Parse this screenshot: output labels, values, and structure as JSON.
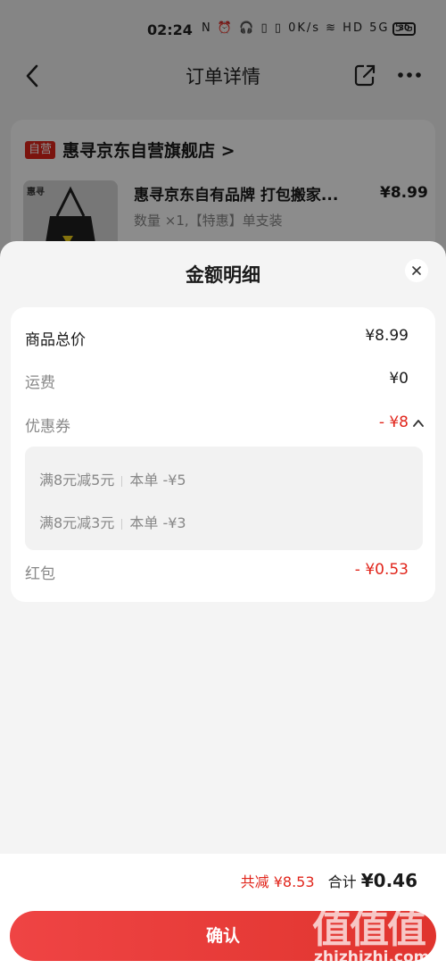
{
  "status_bar": {
    "time": "02:24",
    "icons_text": "N ⏰ 🎧 ▯ ▯ 0K/s ≋ HD 5G 5G",
    "battery": "30"
  },
  "nav": {
    "title": "订单详情",
    "icons": [
      "back-icon",
      "share-icon",
      "more-icon"
    ]
  },
  "store": {
    "badge": "自营",
    "name": "惠寻京东自营旗舰店 >",
    "product": {
      "thumb_tag": "惠寻",
      "title": "惠寻京东自有品牌 打包搬家...",
      "price": "¥8.99",
      "spec": "数量 ×1,【特惠】单支装"
    }
  },
  "sheet": {
    "title": "金额明细",
    "rows": {
      "total": {
        "label": "商品总价",
        "value": "¥8.99"
      },
      "shipping": {
        "label": "运费",
        "value": "¥0"
      },
      "coupon": {
        "label": "优惠券",
        "value": "- ¥8"
      },
      "redpacket": {
        "label": "红包",
        "value": "- ¥0.53"
      }
    },
    "coupons": [
      {
        "name": "满8元减5元",
        "detail": "本单 -¥5"
      },
      {
        "name": "满8元减3元",
        "detail": "本单 -¥3"
      }
    ]
  },
  "footer": {
    "discount": "共减 ¥8.53",
    "sum_label": "合计",
    "sum_value": "¥0.46",
    "confirm": "确认"
  },
  "watermark": {
    "big": "值值值",
    "small": "zhizhizhi.com"
  },
  "colors": {
    "accent": "#e1251b",
    "button": "#e83a35"
  }
}
